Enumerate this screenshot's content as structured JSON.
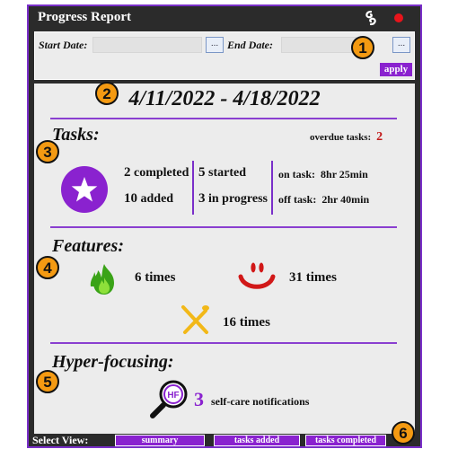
{
  "window": {
    "title": "Progress Report",
    "help_icon": "help-swirl-icon",
    "close_icon": "close-dot-icon"
  },
  "dates": {
    "start_label": "Start Date:",
    "start_value": "",
    "end_label": "End Date:",
    "end_value": "",
    "picker_label": "...",
    "apply_label": "apply"
  },
  "report": {
    "range": "4/11/2022 - 4/18/2022"
  },
  "tasks": {
    "title": "Tasks:",
    "overdue_label": "overdue tasks:",
    "overdue_count": "2",
    "completed_n": "2",
    "completed_label": "completed",
    "added_n": "10",
    "added_label": "added",
    "started_n": "5",
    "started_label": "started",
    "in_progress_n": "3",
    "in_progress_label": "in progress",
    "on_task_label": "on task:",
    "on_task_value": "8hr 25min",
    "off_task_label": "off task:",
    "off_task_value": "2hr 40min"
  },
  "features": {
    "title": "Features:",
    "items": [
      {
        "icon": "green-fire-icon",
        "text": "6 times"
      },
      {
        "icon": "smiley-icon",
        "text": "31 times"
      },
      {
        "icon": "crossed-utensils-icon",
        "text": "16 times"
      }
    ]
  },
  "hyperfocus": {
    "title": "Hyper-focusing:",
    "icon": "magnifier-hf-icon",
    "icon_text": "HF",
    "count": "3",
    "text": "self-care notifications"
  },
  "view": {
    "label": "Select View:",
    "buttons": [
      "summary",
      "tasks added",
      "tasks completed"
    ]
  },
  "callouts": [
    "1",
    "2",
    "3",
    "4",
    "5",
    "6"
  ],
  "colors": {
    "accent": "#8a22cf",
    "overdue": "#c21818",
    "callout": "#f49a12",
    "frame": "#2b2b2b",
    "panel": "#ececec"
  }
}
